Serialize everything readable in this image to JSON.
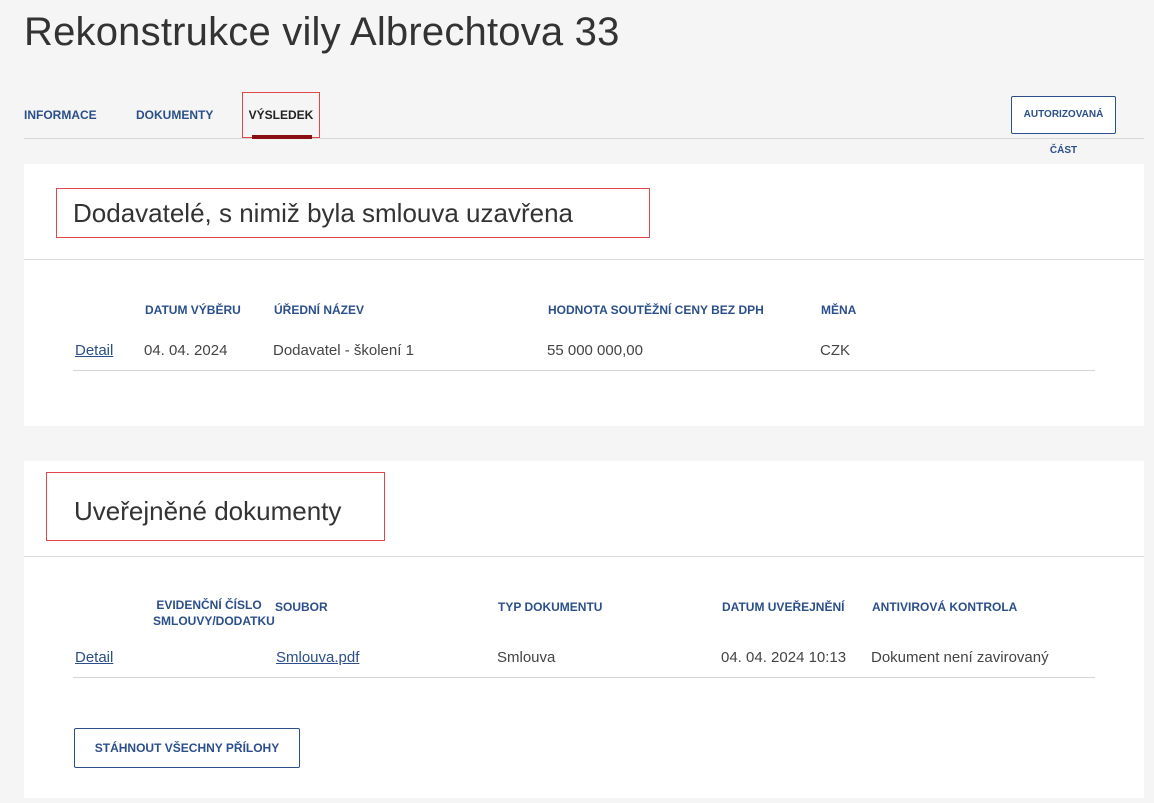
{
  "page": {
    "title": "Rekonstrukce vily Albrechtova 33"
  },
  "tabs": {
    "info": "INFORMACE",
    "docs": "DOKUMENTY",
    "result": "VÝSLEDEK"
  },
  "auth_button": "AUTORIZOVANÁ ČÁST",
  "suppliers": {
    "title": "Dodavatelé, s nimiž byla smlouva uzavřena",
    "headers": [
      "DATUM VÝBĚRU",
      "ÚŘEDNÍ NÁZEV",
      "HODNOTA SOUTĚŽNÍ CENY BEZ DPH",
      "MĚNA"
    ],
    "rows": [
      {
        "detail": "Detail",
        "date": "04. 04. 2024",
        "name": "Dodavatel - školení 1",
        "value": "55 000 000,00",
        "currency": "CZK"
      }
    ]
  },
  "documents": {
    "title": "Uveřejněné dokumenty",
    "headers": {
      "evid_line1": "EVIDENČNÍ ČÍSLO",
      "evid_line2": "SMLOUVY/DODATKU",
      "file": "SOUBOR",
      "type": "TYP DOKUMENTU",
      "published": "DATUM UVEŘEJNĚNÍ",
      "antivirus": "ANTIVIROVÁ KONTROLA"
    },
    "rows": [
      {
        "detail": "Detail",
        "file": "Smlouva.pdf",
        "type": "Smlouva",
        "published": "04. 04. 2024 10:13",
        "antivirus": "Dokument není zavirovaný"
      }
    ],
    "download_all": "STÁHNOUT VŠECHNY PŘÍLOHY"
  }
}
